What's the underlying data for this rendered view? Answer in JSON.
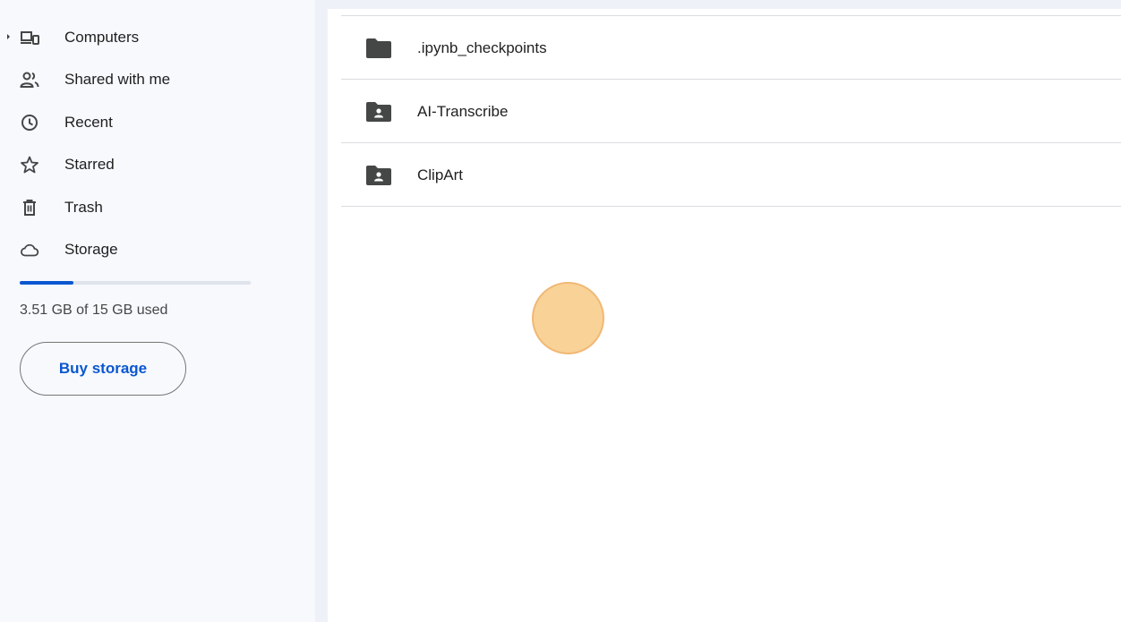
{
  "sidebar": {
    "items": [
      {
        "label": "Computers",
        "icon": "computers-icon"
      },
      {
        "label": "Shared with me",
        "icon": "shared-with-me-icon"
      },
      {
        "label": "Recent",
        "icon": "recent-clock-icon"
      },
      {
        "label": "Starred",
        "icon": "star-icon"
      },
      {
        "label": "Trash",
        "icon": "trash-icon"
      },
      {
        "label": "Storage",
        "icon": "cloud-icon"
      }
    ],
    "storage": {
      "used_text": "3.51 GB of 15 GB used",
      "used_fraction": 0.234
    },
    "buy_storage_label": "Buy storage"
  },
  "files": [
    {
      "name": ".ipynb_checkpoints",
      "type": "folder",
      "icon": "folder-icon"
    },
    {
      "name": "AI-Transcribe",
      "type": "shared-folder",
      "icon": "shared-folder-icon"
    },
    {
      "name": "ClipArt",
      "type": "shared-folder",
      "icon": "shared-folder-icon"
    }
  ],
  "colors": {
    "accent": "#0b57d0",
    "page_background": "#eef1f8",
    "icon": "#444746",
    "cursor_highlight": "#f9cf8f"
  }
}
